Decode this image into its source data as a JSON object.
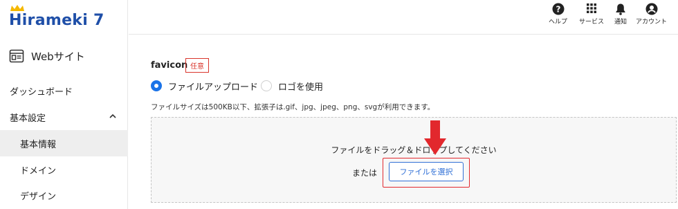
{
  "brand": {
    "logo_text": "Hirameki 7"
  },
  "sidebar": {
    "site_label": "Webサイト",
    "items": [
      {
        "label": "ダッシュボード"
      },
      {
        "label": "基本設定"
      },
      {
        "label": "基本情報"
      },
      {
        "label": "ドメイン"
      },
      {
        "label": "デザイン"
      }
    ]
  },
  "header": {
    "help": "ヘルプ",
    "services": "サービス",
    "notifications": "通知",
    "account": "アカウント"
  },
  "main": {
    "field_title": "favicon",
    "required_badge": "任意",
    "radio_upload": "ファイルアップロード",
    "radio_logo": "ロゴを使用",
    "note": "ファイルサイズは500KB以下、拡張子は.gif、jpg、jpeg、png、svgが利用できます。",
    "drop_text": "ファイルをドラッグ＆ドロップしてください",
    "or_text": "または",
    "choose_button": "ファイルを選択"
  },
  "colors": {
    "accent": "#1a73e8",
    "brand": "#1f4fa8",
    "annotation_red": "#e2282d"
  }
}
